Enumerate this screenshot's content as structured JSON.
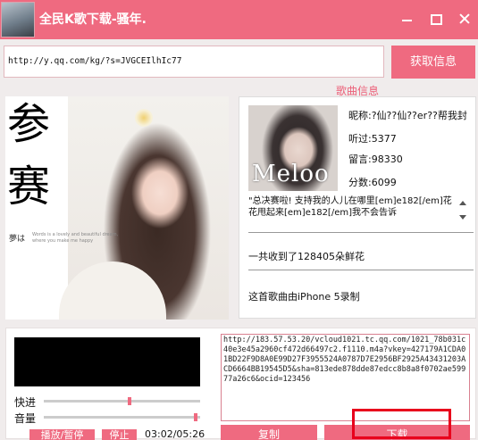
{
  "window": {
    "title": "全民K歌下载-骚年.",
    "avatar_icon": "user-avatar",
    "accent_color": "#ef6a80"
  },
  "toolbar": {
    "url_value": "http://y.qq.com/kg/?s=JVGCEIlhIc77",
    "fetch_label": "获取信息"
  },
  "section": {
    "song_info_label": "歌曲信息"
  },
  "cover": {
    "char1": "参",
    "char2": "赛",
    "small_text": "夢は",
    "fine_text": "Words is a lovely and beautiful dream, where you make me happy"
  },
  "info": {
    "meloo_text": "Meloo",
    "nickname": "昵称:?仙??仙??er??帮我封",
    "listens": "听过:5377",
    "comments": "留言:98330",
    "score": "分数:6099",
    "description": "\"总决赛啦! 支持我的人儿在哪里[em]e182[/em]花花甩起来[em]e182[/em]我不会告诉",
    "flowers": "一共收到了128405朵鲜花",
    "device": "这首歌曲由iPhone 5录制"
  },
  "player": {
    "progress_label": "快进",
    "volume_label": "音量",
    "progress": 0.55,
    "volume": 0.97,
    "play_label": "播放/暂停",
    "stop_label": "停止",
    "time": "03:02/05:26",
    "stream_url": "http://183.57.53.20/vcloud1021.tc.qq.com/1021_78b031c40e3e45a2960cf472d66497c2.f1110.m4a?vkey=427179A1CDA01BD22F9D8A0E99D27F3955524A0787D7E2956BF2925A43431203ACD6664BB19545D5&sha=813ede878dde87edcc8b8a8f0702ae59977a26c6&ocid=123456",
    "copy_label": "复制",
    "download_label": "下载"
  }
}
